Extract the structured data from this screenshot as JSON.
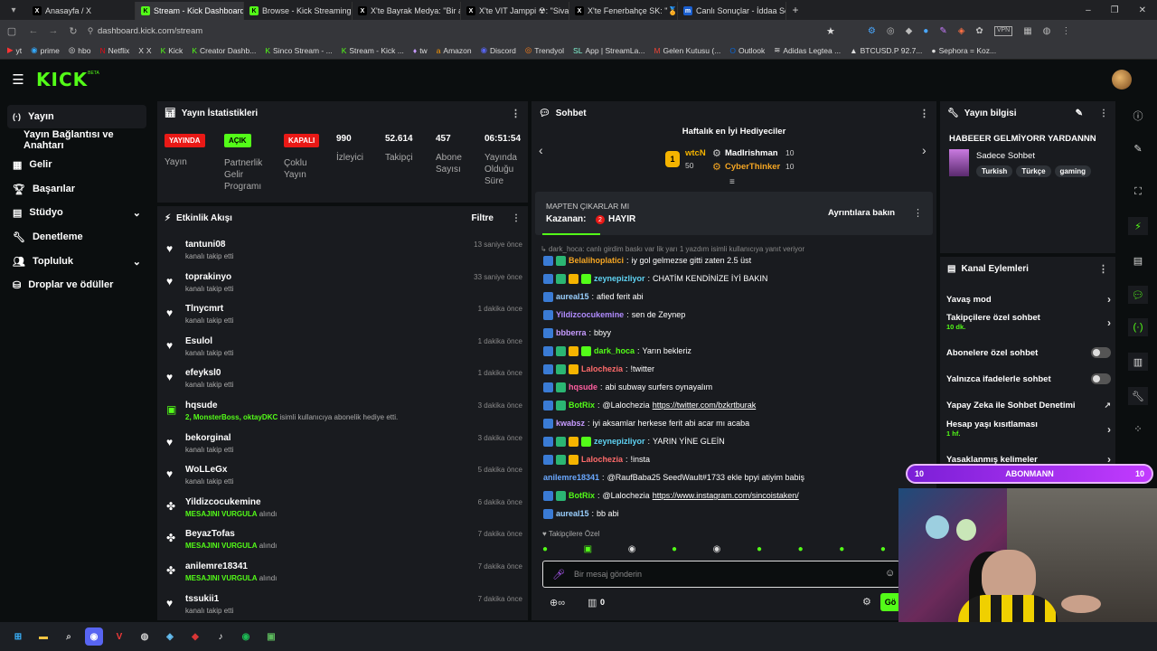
{
  "browser": {
    "tabs": [
      {
        "label": "Anasayfa / X",
        "icon": "x-icon"
      },
      {
        "label": "Stream - Kick Dashboard",
        "icon": "kick-icon"
      },
      {
        "label": "Browse - Kick Streaming",
        "icon": "kick-icon"
      },
      {
        "label": "X'te Bayrak Medya: \"Bir adı",
        "icon": "x-icon"
      },
      {
        "label": "X'te VIT Jamppi ☢: \"Sivasl",
        "icon": "x-icon"
      },
      {
        "label": "X'te Fenerbahçe SK: \"🏅 Yo",
        "icon": "x-icon"
      },
      {
        "label": "Canlı Sonuçlar - İddaa Son",
        "icon": "mackolik-icon"
      }
    ],
    "url": "dashboard.kick.com/stream",
    "bookmarks": [
      "yt",
      "prime",
      "hbo",
      "Netflix",
      "X",
      "Kick",
      "Creator Dashb...",
      "Sinco Stream - ...",
      "Stream - Kick ...",
      "tw",
      "Amazon",
      "Discord",
      "Trendyol",
      "App | StreamLa...",
      "Gelen Kutusu (...",
      "Outlook",
      "Adidas Legtea ...",
      "BTCUSD.P 92.7...",
      "Sephora = Koz..."
    ]
  },
  "kick": {
    "logo": "KICK",
    "beta": "BETA"
  },
  "sidebar": {
    "items": [
      {
        "label": "Yayın",
        "icon": "broadcast-icon"
      },
      {
        "label": "Yayın Bağlantısı ve Anahtarı"
      },
      {
        "label": "Gelir",
        "icon": "revenue-icon"
      },
      {
        "label": "Başarılar",
        "icon": "trophy-icon"
      },
      {
        "label": "Stüdyo",
        "icon": "studio-icon"
      },
      {
        "label": "Denetleme",
        "icon": "wrench-icon"
      },
      {
        "label": "Topluluk",
        "icon": "community-icon"
      },
      {
        "label": "Droplar ve ödüller",
        "icon": "drops-icon"
      }
    ]
  },
  "stats": {
    "title": "Yayın İstatistikleri",
    "yayinda": "YAYINDA",
    "yayin": "Yayın",
    "acik": "AÇIK",
    "partner": "Partnerlik Gelir Programı",
    "kapali": "KAPALI",
    "coklu": "Çoklu Yayın",
    "viewers": "990",
    "viewers_label": "İzleyici",
    "followers": "52.614",
    "followers_label": "Takipçi",
    "subs": "457",
    "subs_label": "Abone Sayısı",
    "uptime": "06:51:54",
    "uptime_label": "Yayında Olduğu Süre"
  },
  "activity": {
    "title": "Etkinlik Akışı",
    "filter": "Filtre",
    "items": [
      {
        "name": "tantuni08",
        "sub": "kanalı takip etti",
        "time": "13 saniye önce",
        "type": "follow"
      },
      {
        "name": "toprakinyo",
        "sub": "kanalı takip etti",
        "time": "33 saniye önce",
        "type": "follow"
      },
      {
        "name": "Tlnycmrt",
        "sub": "kanalı takip etti",
        "time": "1 dakika önce",
        "type": "follow"
      },
      {
        "name": "Esulol",
        "sub": "kanalı takip etti",
        "time": "1 dakika önce",
        "type": "follow"
      },
      {
        "name": "efeyksl0",
        "sub": "kanalı takip etti",
        "time": "1 dakika önce",
        "type": "follow"
      },
      {
        "name": "hqsude",
        "sub_hl": "2, MonsterBoss, oktayDKC",
        "sub": "isimli kullanıcıya abonelik hediye etti.",
        "time": "3 dakika önce",
        "type": "gift"
      },
      {
        "name": "bekorginal",
        "sub": "kanalı takip etti",
        "time": "3 dakika önce",
        "type": "follow"
      },
      {
        "name": "WoLLeGx",
        "sub": "kanalı takip etti",
        "time": "5 dakika önce",
        "type": "follow"
      },
      {
        "name": "Yildizcocukemine",
        "sub_hl": "MESAJINI VURGULA",
        "sub": "alındı",
        "time": "6 dakika önce",
        "type": "reward"
      },
      {
        "name": "BeyazTofas",
        "sub_hl": "MESAJINI VURGULA",
        "sub": "alındı",
        "time": "7 dakika önce",
        "type": "reward"
      },
      {
        "name": "anilemre18341",
        "sub_hl": "MESAJINI VURGULA",
        "sub": "alındı",
        "time": "7 dakika önce",
        "type": "reward"
      },
      {
        "name": "tssukii1",
        "sub": "kanalı takip etti",
        "time": "7 dakika önce",
        "type": "follow"
      }
    ]
  },
  "chat": {
    "title": "Sohbet",
    "leaderboard_title": "Haftalık en İyi Hediyeciler",
    "top1": {
      "name": "wtcN",
      "amount": "50"
    },
    "top2": {
      "name": "Madlrishman",
      "amount": "10"
    },
    "top3": {
      "name": "CyberThinker",
      "amount": "10"
    },
    "prediction_title": "MAPTEN ÇIKARLAR MI",
    "prediction_winner_label": "Kazanan:",
    "prediction_winner": "HAYIR",
    "prediction_details": "Ayrıntılara bakın",
    "reply_hint": "dark_hoca: canlı girdim baskı var lik yarı 1 yazdım isimli kullanıcıya yanıt veriyor",
    "messages": [
      {
        "user": "Belalihoplatici",
        "text": "iy gol gelmezse gitti zaten 2.5 üst",
        "color": "#f5a623",
        "icons": 2
      },
      {
        "user": "zeynepizliyor",
        "text": "CHATİM KENDİNİZE İYİ BAKIN",
        "color": "#5fd3f3",
        "icons": 4
      },
      {
        "user": "aureal15",
        "text": "afied ferit abi",
        "color": "#9ad0ff",
        "icons": 1
      },
      {
        "user": "Yildizcocukemine",
        "text": "sen de Zeynep",
        "color": "#b18cff",
        "icons": 1
      },
      {
        "user": "bbberra",
        "text": "bbyy",
        "color": "#c79bff",
        "icons": 1
      },
      {
        "user": "dark_hoca",
        "text": "Yarın bekleriz",
        "color": "#53fc18",
        "icons": 4
      },
      {
        "user": "Lalochezia",
        "text": "!twitter",
        "color": "#ff6b6b",
        "icons": 3
      },
      {
        "user": "hqsude",
        "text": "abi subway surfers oynayalım",
        "color": "#ff5fa0",
        "icons": 2
      },
      {
        "user": "BotRix",
        "text": "@Lalochezia",
        "link": "https://twitter.com/bzkrtburak",
        "color": "#53fc18",
        "icons": 2
      },
      {
        "user": "kwabsz",
        "text": "iyi aksamlar herkese ferit abi acar mı acaba",
        "color": "#c79bff",
        "icons": 1
      },
      {
        "user": "zeynepizliyor",
        "text": "YARIN YİNE GLEİN",
        "color": "#5fd3f3",
        "icons": 4
      },
      {
        "user": "Lalochezia",
        "text": "!insta",
        "color": "#ff6b6b",
        "icons": 3
      },
      {
        "user": "anilemre18341",
        "text": "@RaufBaba25 SeedWault#1733 ekle bpyi atiyim babiş",
        "color": "#6aa8ff",
        "icons": 0
      },
      {
        "user": "BotRix",
        "text": "@Lalochezia",
        "link": "https://www.instagram.com/sincoistaken/",
        "color": "#53fc18",
        "icons": 2
      },
      {
        "user": "aureal15",
        "text": "bb abi",
        "color": "#9ad0ff",
        "icons": 1
      }
    ],
    "followers_only": "Takipçilere Özel",
    "input_placeholder": "Bir mesaj gönderin",
    "count": "0",
    "send_label": "Gö"
  },
  "info": {
    "title": "Yayın bilgisi",
    "stream_title": "HABEEER GELMİYORR YARDANNN",
    "category": "Sadece Sohbet",
    "tags": [
      "Turkish",
      "Türkçe",
      "gaming"
    ]
  },
  "actions": {
    "title": "Kanal Eylemleri",
    "items": [
      {
        "label": "Yavaş mod",
        "kind": "chevron"
      },
      {
        "label": "Takipçilere özel sohbet",
        "sub": "10 dk.",
        "kind": "chevron"
      },
      {
        "label": "Abonelere özel sohbet",
        "kind": "toggle"
      },
      {
        "label": "Yalnızca ifadelerle sohbet",
        "kind": "toggle"
      },
      {
        "label": "Yapay Zeka ile Sohbet Denetimi",
        "kind": "external"
      },
      {
        "label": "Hesap yaşı kısıtlaması",
        "sub": "1 hf.",
        "kind": "chevron"
      },
      {
        "label": "Yasaklanmış kelimeler",
        "kind": "chevron"
      }
    ]
  },
  "overlay": {
    "left": "10",
    "label": "ABONMANN",
    "right": "10"
  },
  "colors": {
    "accent": "#53fc18",
    "live": "#e91916",
    "bg": "#0b0e0f",
    "panel": "#191b1f"
  }
}
